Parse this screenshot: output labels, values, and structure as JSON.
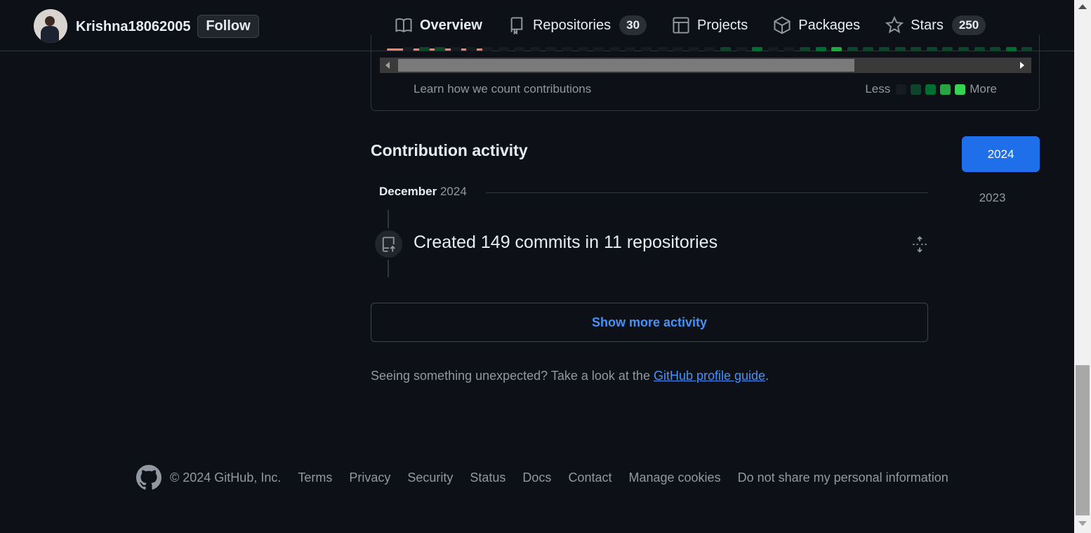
{
  "header": {
    "username": "Krishna18062005",
    "follow_label": "Follow",
    "tabs": [
      {
        "label": "Overview",
        "icon": "book-icon",
        "active": true
      },
      {
        "label": "Repositories",
        "icon": "repo-icon",
        "count": "30"
      },
      {
        "label": "Projects",
        "icon": "table-icon"
      },
      {
        "label": "Packages",
        "icon": "package-icon"
      },
      {
        "label": "Stars",
        "icon": "star-icon",
        "count": "250"
      }
    ]
  },
  "calendar": {
    "learn_link": "Learn how we count contributions",
    "legend_less": "Less",
    "legend_more": "More",
    "legend_colors": [
      "#161b22",
      "#0e4429",
      "#006d32",
      "#26a641",
      "#39d353"
    ]
  },
  "activity": {
    "title": "Contribution activity",
    "years": [
      "2024",
      "2023"
    ],
    "selected_year": "2024",
    "month": "December",
    "month_year": "2024",
    "commit_summary": "Created 149 commits in 11 repositories",
    "show_more": "Show more activity",
    "unexpected_prefix": "Seeing something unexpected? Take a look at the",
    "guide_link": "GitHub profile guide",
    "unexpected_suffix": "."
  },
  "footer": {
    "copyright": "© 2024 GitHub, Inc.",
    "links": [
      "Terms",
      "Privacy",
      "Security",
      "Status",
      "Docs",
      "Contact",
      "Manage cookies",
      "Do not share my personal information"
    ]
  },
  "colors": {
    "background": "#0d1117",
    "accent_blue": "#1f6feb",
    "link_blue": "#4493f8",
    "tab_underline": "#f78166"
  }
}
